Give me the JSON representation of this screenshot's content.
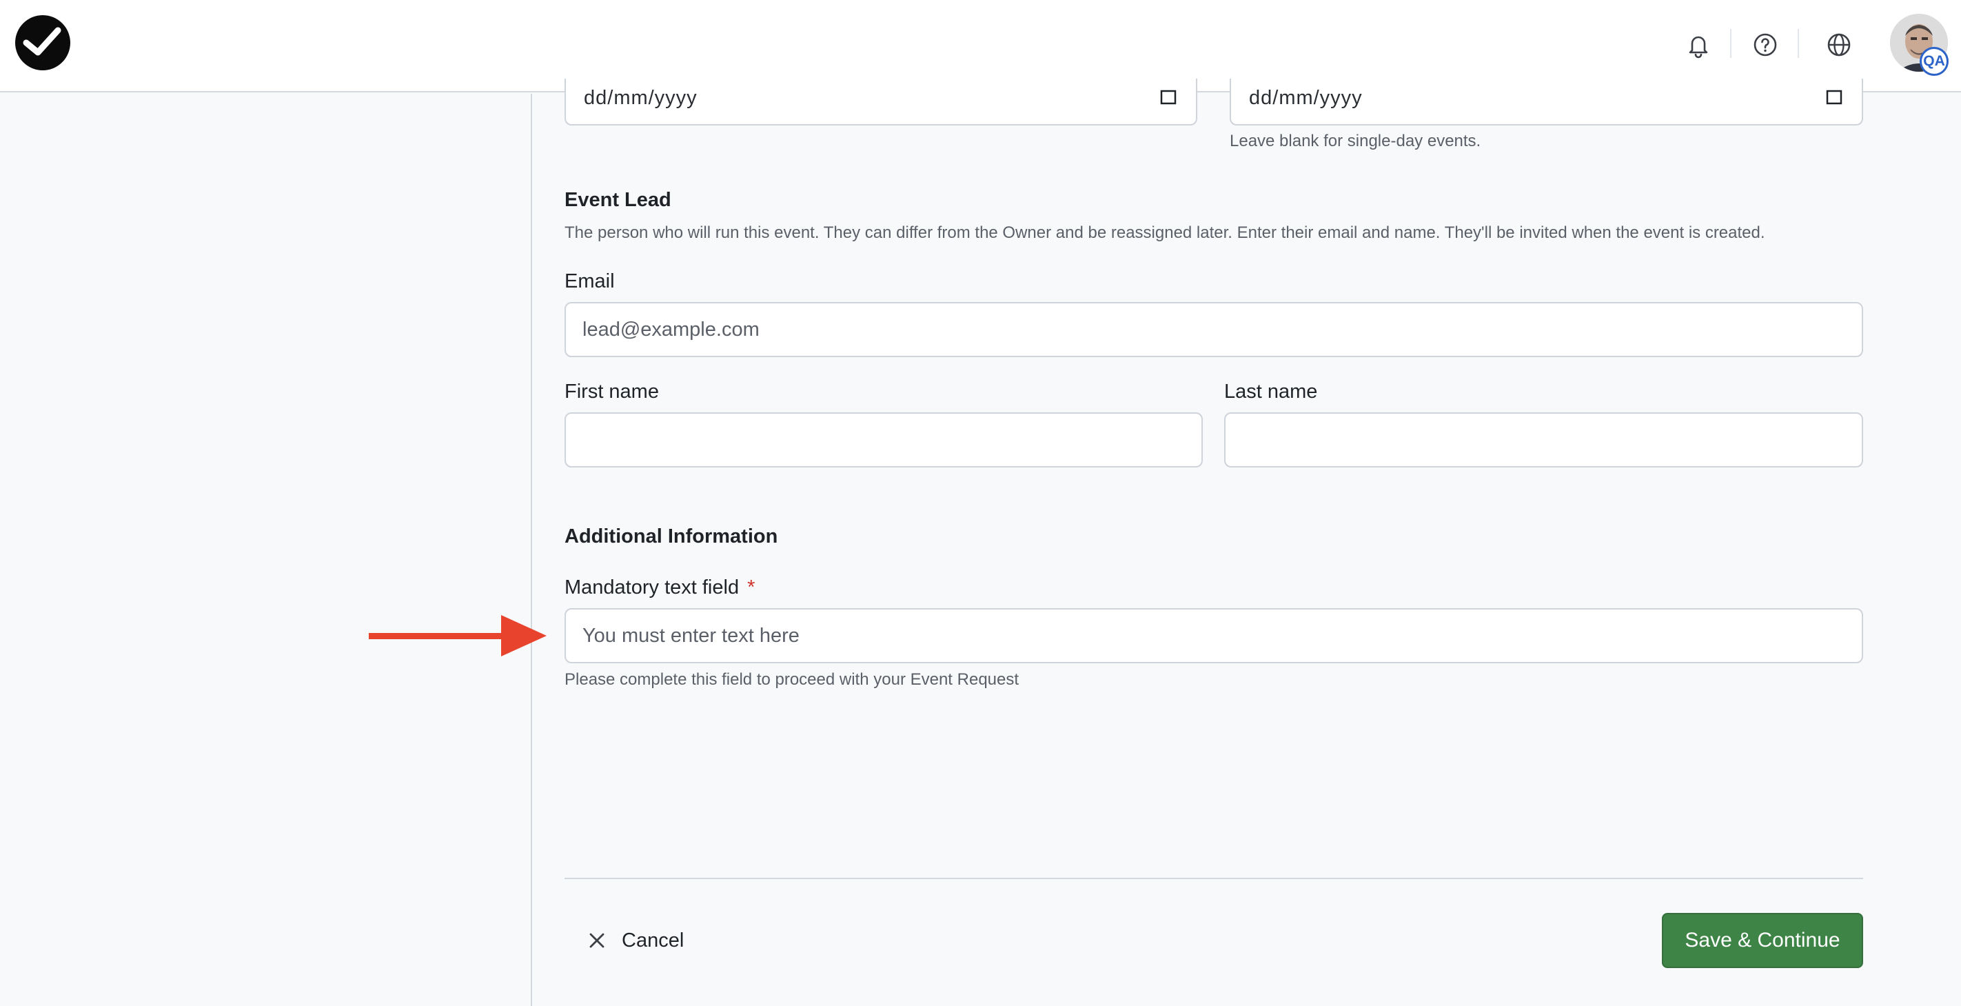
{
  "header": {
    "icons": [
      "bell-icon",
      "help-circle-icon",
      "globe-icon"
    ],
    "avatar_badge": "QA"
  },
  "form": {
    "start_date": {
      "value": "dd/mm/yyyy"
    },
    "end_date": {
      "value": "dd/mm/yyyy",
      "help": "Leave blank for single-day events."
    },
    "event_lead": {
      "title": "Event Lead",
      "description": "The person who will run this event. They can differ from the Owner and be reassigned later. Enter their email and name. They'll be invited when the event is created.",
      "email_label": "Email",
      "email_placeholder": "lead@example.com",
      "first_name_label": "First name",
      "last_name_label": "Last name"
    },
    "additional_info": {
      "title": "Additional Information",
      "mandatory_label": "Mandatory text field",
      "required_marker": "*",
      "mandatory_placeholder": "You must enter text here",
      "mandatory_help": "Please complete this field to proceed with your Event Request"
    }
  },
  "footer": {
    "cancel_label": "Cancel",
    "save_label": "Save & Continue"
  },
  "colors": {
    "primary_button": "#3f8447",
    "required": "#d0342c",
    "annotation_arrow": "#e8432c",
    "badge": "#2c63c9"
  }
}
